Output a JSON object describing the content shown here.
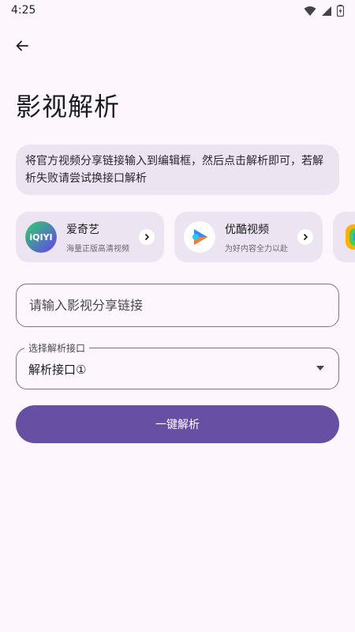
{
  "status_bar": {
    "time": "4:25"
  },
  "page": {
    "title": "影视解析"
  },
  "info": {
    "text": "将官方视频分享链接输入到编辑框，然后点击解析即可，若解析失败请尝试换接口解析"
  },
  "platforms": [
    {
      "name": "爱奇艺",
      "subtitle": "海量正版高清视频",
      "logo_text": "iQIYI",
      "logo_color": "#1fc04f"
    },
    {
      "name": "优酷视频",
      "subtitle": "为好内容全力以赴",
      "logo_color": "#2e8cff"
    }
  ],
  "link_input": {
    "placeholder": "请输入影视分享链接"
  },
  "interface_select": {
    "label": "选择解析接口",
    "value": "解析接口①"
  },
  "parse_button": {
    "label": "一键解析"
  },
  "colors": {
    "primary": "#6750a4",
    "surface": "#fdf7fd",
    "card": "#ece4f0"
  }
}
